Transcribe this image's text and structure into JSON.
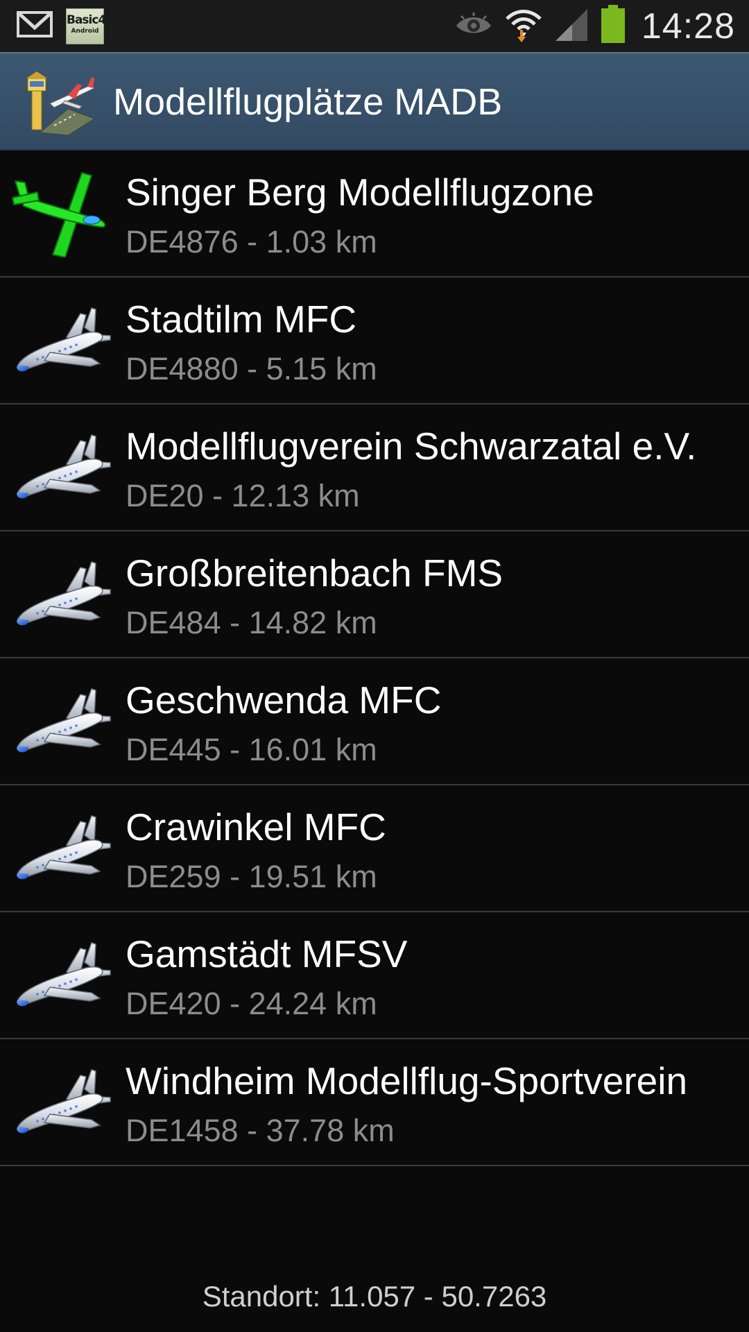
{
  "status_bar": {
    "left_icons": [
      "gmail-icon",
      "basic4android-icon"
    ],
    "basic_icon_text_top": "Basic4",
    "basic_icon_text_bottom": "Android",
    "right_icons": [
      "eye-icon",
      "wifi-icon",
      "signal-icon",
      "battery-icon"
    ],
    "time": "14:28"
  },
  "app_bar": {
    "title": "Modellflugplätze MADB",
    "icon": "control-tower-airplane-icon"
  },
  "list": {
    "items": [
      {
        "name": "Singer Berg Modellflugzone",
        "detail": "DE4876 - 1.03 km",
        "icon": "green-glider-icon"
      },
      {
        "name": "Stadtilm MFC",
        "detail": "DE4880 - 5.15 km",
        "icon": "airplane-icon"
      },
      {
        "name": "Modellflugverein Schwarzatal e.V.",
        "detail": "DE20 - 12.13 km",
        "icon": "airplane-icon"
      },
      {
        "name": "Großbreitenbach FMS",
        "detail": "DE484 - 14.82 km",
        "icon": "airplane-icon"
      },
      {
        "name": "Geschwenda MFC",
        "detail": "DE445 - 16.01 km",
        "icon": "airplane-icon"
      },
      {
        "name": "Crawinkel MFC",
        "detail": "DE259 - 19.51 km",
        "icon": "airplane-icon"
      },
      {
        "name": "Gamstädt MFSV",
        "detail": "DE420 - 24.24 km",
        "icon": "airplane-icon"
      },
      {
        "name": "Windheim Modellflug-Sportverein",
        "detail": "DE1458 - 37.78 km",
        "icon": "airplane-icon"
      }
    ]
  },
  "footer": {
    "location": "Standort: 11.057 - 50.7263"
  },
  "colors": {
    "app_bar": "#3a536c",
    "background": "#0a0a0a",
    "primary_text": "#ffffff",
    "secondary_text": "#8c8c8c",
    "battery": "#7bb81e",
    "glider": "#22e022"
  }
}
